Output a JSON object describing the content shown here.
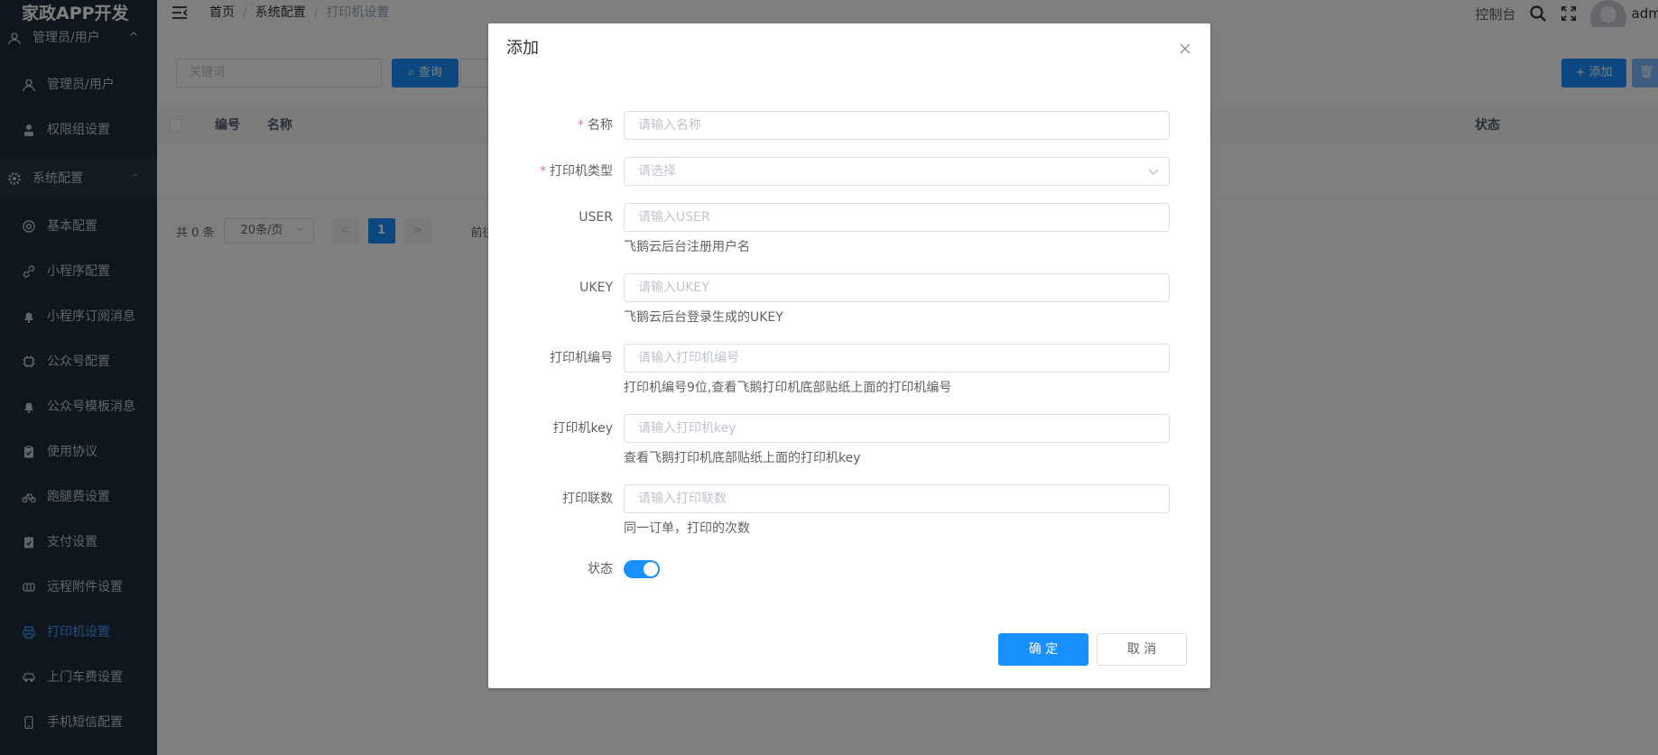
{
  "app": {
    "logo": "家政APP开发"
  },
  "sidebar": {
    "partial_label": "管理员/用户",
    "items": [
      {
        "label": "管理员/用户",
        "icon": "user-icon"
      },
      {
        "label": "权限组设置",
        "icon": "user-group-icon"
      }
    ],
    "group": {
      "label": "系统配置",
      "icon": "gear-icon",
      "caret": "^"
    },
    "sub_items": [
      {
        "label": "基本配置",
        "icon": "gear-outline-icon"
      },
      {
        "label": "小程序配置",
        "icon": "link-icon"
      },
      {
        "label": "小程序订阅消息",
        "icon": "bell-icon"
      },
      {
        "label": "公众号配置",
        "icon": "chip-icon"
      },
      {
        "label": "公众号模板消息",
        "icon": "bell-icon"
      },
      {
        "label": "使用协议",
        "icon": "clipboard-icon"
      },
      {
        "label": "跑腿费设置",
        "icon": "bicycle-icon"
      },
      {
        "label": "支付设置",
        "icon": "clipboard-check-icon"
      },
      {
        "label": "远程附件设置",
        "icon": "attachment-icon"
      },
      {
        "label": "打印机设置",
        "icon": "printer-icon",
        "active": true
      },
      {
        "label": "上门车费设置",
        "icon": "car-icon"
      },
      {
        "label": "手机短信配置",
        "icon": "phone-icon"
      }
    ]
  },
  "topbar": {
    "breadcrumb": [
      "首页",
      "系统配置",
      "打印机设置"
    ],
    "sep": "/",
    "control_panel": "控制台",
    "user": "admi"
  },
  "main": {
    "search_placeholder": "关键词",
    "query_button": "查询",
    "add_button": "+ 添加",
    "delete_button": "🗑",
    "columns": [
      "编号",
      "名称",
      "状态"
    ],
    "pager": {
      "total": "共 0 条",
      "size": "20条/页",
      "prev": "<",
      "next": ">",
      "page": "1",
      "goto": "前往"
    }
  },
  "dialog": {
    "title": "添加",
    "fields": [
      {
        "label": "名称",
        "required": true,
        "placeholder": "请输入名称"
      },
      {
        "label": "打印机类型",
        "required": true,
        "placeholder": "请选择",
        "select": true
      },
      {
        "label": "USER",
        "placeholder": "请输入USER",
        "tip": "飞鹅云后台注册用户名"
      },
      {
        "label": "UKEY",
        "placeholder": "请输入UKEY",
        "tip": "飞鹅云后台登录生成的UKEY"
      },
      {
        "label": "打印机编号",
        "placeholder": "请输入打印机编号",
        "tip": "打印机编号9位,查看飞鹅打印机底部贴纸上面的打印机编号"
      },
      {
        "label": "打印机key",
        "placeholder": "请输入打印机key",
        "tip": "查看飞鹅打印机底部贴纸上面的打印机key"
      },
      {
        "label": "打印联数",
        "placeholder": "请输入打印联数",
        "tip": "同一订单，打印的次数"
      }
    ],
    "status_label": "状态",
    "required_mark": "*",
    "ok_button": "确 定",
    "cancel_button": "取 消"
  },
  "colors": {
    "primary": "#1890ff",
    "sidebar_bg": "#1f2d3d",
    "required": "#f56c6c"
  }
}
